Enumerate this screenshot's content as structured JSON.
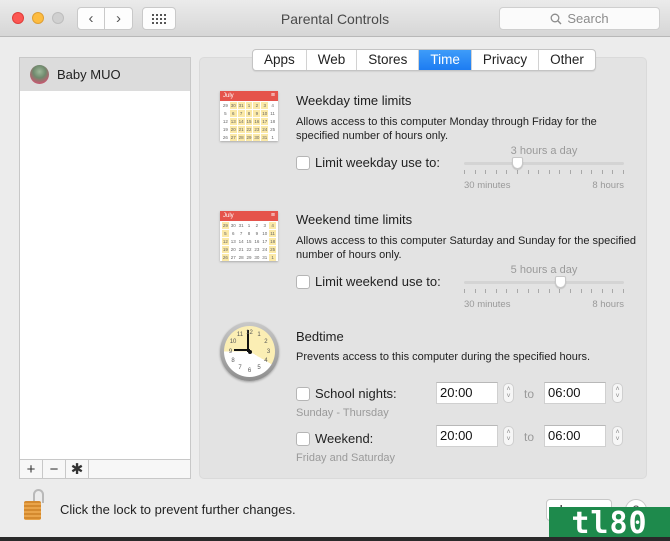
{
  "window": {
    "title": "Parental Controls",
    "search_placeholder": "Search",
    "nav_back": "‹",
    "nav_forward": "›"
  },
  "sidebar": {
    "users": [
      {
        "name": "Baby MUO",
        "selected": true
      }
    ],
    "toolbar": {
      "add": "+",
      "remove": "−",
      "settings": "✱"
    }
  },
  "tabs": [
    {
      "label": "Apps",
      "active": false
    },
    {
      "label": "Web",
      "active": false
    },
    {
      "label": "Stores",
      "active": false
    },
    {
      "label": "Time",
      "active": true
    },
    {
      "label": "Privacy",
      "active": false
    },
    {
      "label": "Other",
      "active": false
    }
  ],
  "calendar_icon": {
    "month": "July"
  },
  "weekday": {
    "title": "Weekday time limits",
    "description": "Allows access to this computer Monday through Friday for the specified number of hours only.",
    "checkbox_label": "Limit weekday use to:",
    "checked": false,
    "slider": {
      "value_label": "3 hours a day",
      "value_hours": 3,
      "min_label": "30 minutes",
      "max_label": "8 hours",
      "min_hours": 0.5,
      "max_hours": 8,
      "tick_count": 16
    }
  },
  "weekend": {
    "title": "Weekend time limits",
    "description": "Allows access to this computer Saturday and Sunday for the specified number of hours only.",
    "checkbox_label": "Limit weekend use to:",
    "checked": false,
    "slider": {
      "value_label": "5 hours a day",
      "value_hours": 5,
      "min_label": "30 minutes",
      "max_label": "8 hours",
      "min_hours": 0.5,
      "max_hours": 8,
      "tick_count": 16
    }
  },
  "bedtime": {
    "title": "Bedtime",
    "description": "Prevents access to this computer during the specified hours.",
    "to_label": "to",
    "school_nights": {
      "label": "School nights:",
      "sublabel": "Sunday - Thursday",
      "checked": false,
      "from": "20:00",
      "to": "06:00"
    },
    "weekend": {
      "label": "Weekend:",
      "sublabel": "Friday and Saturday",
      "checked": false,
      "from": "20:00",
      "to": "06:00"
    }
  },
  "footer": {
    "lock_text": "Click the lock to prevent further changes.",
    "logs_button": "Logs...",
    "help_button": "?"
  },
  "watermark": "tl80"
}
